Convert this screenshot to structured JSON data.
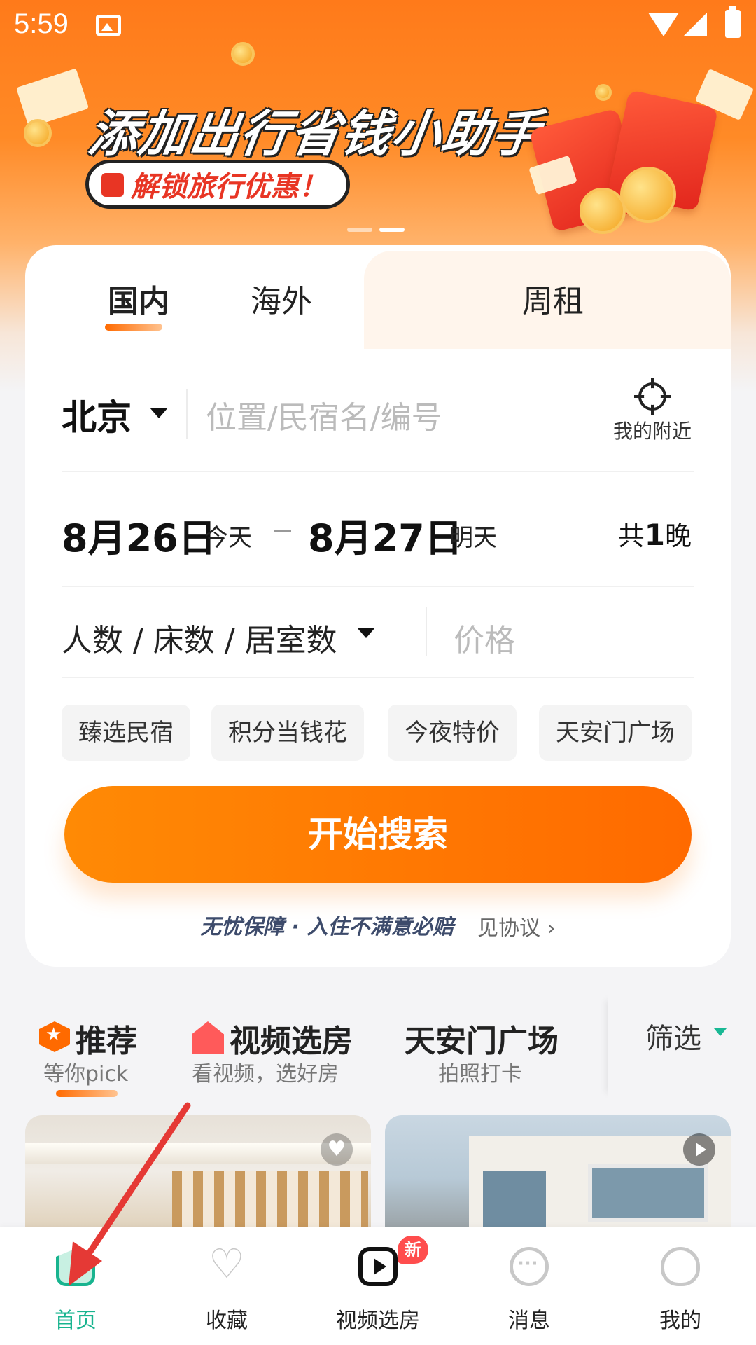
{
  "status_bar": {
    "time": "5:59"
  },
  "banner": {
    "title": "添加出行省钱小助手",
    "pill": "解锁旅行优惠！",
    "dots": 2,
    "active_dot": 1
  },
  "search_tabs": [
    {
      "label": "国内",
      "active": true
    },
    {
      "label": "海外",
      "active": false
    },
    {
      "label": "周租",
      "active": false
    }
  ],
  "location": {
    "city": "北京",
    "placeholder": "位置/民宿名/编号",
    "nearby_label": "我的附近"
  },
  "dates": {
    "checkin": "8月26日",
    "checkin_day": "今天",
    "checkout": "8月27日",
    "checkout_day": "明天",
    "nights_prefix": "共",
    "nights_count": "1",
    "nights_suffix": "晚"
  },
  "guests": {
    "label": "人数 / 床数 / 居室数",
    "price_placeholder": "价格"
  },
  "chips": [
    "臻选民宿",
    "积分当钱花",
    "今夜特价",
    "天安门广场"
  ],
  "search_button": "开始搜索",
  "guarantee": {
    "text": "无忧保障 · 入住不满意必赔",
    "link": "见协议 ›"
  },
  "feed_tabs": [
    {
      "title": "推荐",
      "subtitle": "等你pick",
      "active": true
    },
    {
      "title": "视频选房",
      "subtitle": "看视频，选好房",
      "active": false
    },
    {
      "title": "天安门广场",
      "subtitle": "拍照打卡",
      "active": false
    }
  ],
  "filter": {
    "label": "筛选"
  },
  "bottom_nav": [
    {
      "label": "首页",
      "icon": "home-icon",
      "active": true
    },
    {
      "label": "收藏",
      "icon": "heart-icon",
      "active": false
    },
    {
      "label": "视频选房",
      "icon": "video-icon",
      "active": false,
      "badge": "新"
    },
    {
      "label": "消息",
      "icon": "message-icon",
      "active": false
    },
    {
      "label": "我的",
      "icon": "profile-icon",
      "active": false
    }
  ],
  "colors": {
    "brand_orange": "#ff6a00",
    "nav_active_green": "#18b48f",
    "annotation_arrow": "#e53935"
  }
}
